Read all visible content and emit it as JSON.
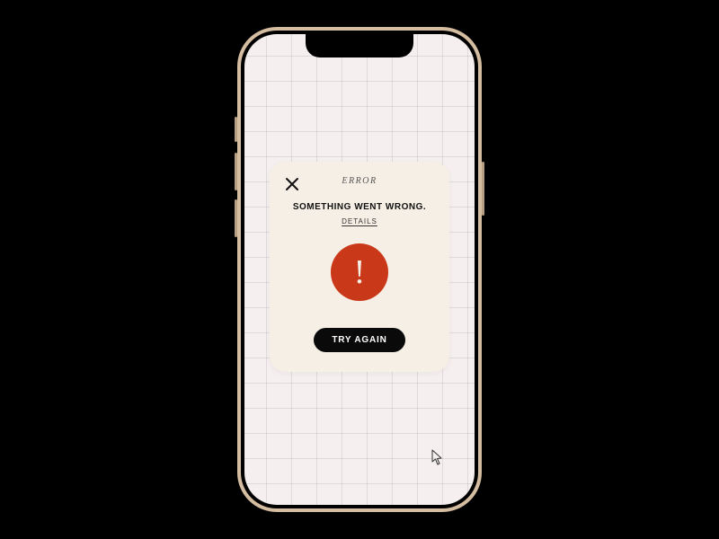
{
  "modal": {
    "title": "ERROR",
    "message": "SOMETHING WENT WRONG.",
    "details_label": "DETAILS",
    "try_again_label": "TRY AGAIN",
    "accent_color": "#c93818"
  }
}
